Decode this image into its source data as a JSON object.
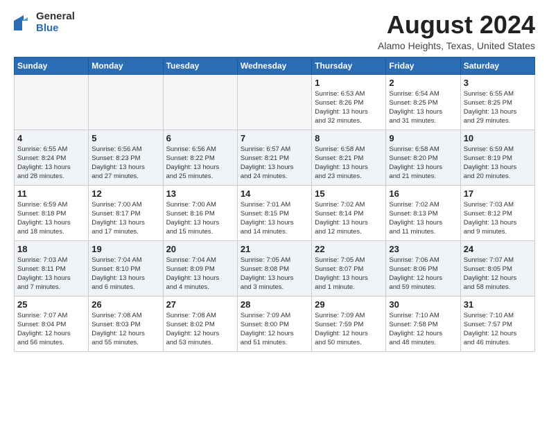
{
  "header": {
    "logo_general": "General",
    "logo_blue": "Blue",
    "month_year": "August 2024",
    "location": "Alamo Heights, Texas, United States"
  },
  "days_of_week": [
    "Sunday",
    "Monday",
    "Tuesday",
    "Wednesday",
    "Thursday",
    "Friday",
    "Saturday"
  ],
  "weeks": [
    [
      {
        "day": "",
        "info": ""
      },
      {
        "day": "",
        "info": ""
      },
      {
        "day": "",
        "info": ""
      },
      {
        "day": "",
        "info": ""
      },
      {
        "day": "1",
        "info": "Sunrise: 6:53 AM\nSunset: 8:26 PM\nDaylight: 13 hours\nand 32 minutes."
      },
      {
        "day": "2",
        "info": "Sunrise: 6:54 AM\nSunset: 8:25 PM\nDaylight: 13 hours\nand 31 minutes."
      },
      {
        "day": "3",
        "info": "Sunrise: 6:55 AM\nSunset: 8:25 PM\nDaylight: 13 hours\nand 29 minutes."
      }
    ],
    [
      {
        "day": "4",
        "info": "Sunrise: 6:55 AM\nSunset: 8:24 PM\nDaylight: 13 hours\nand 28 minutes."
      },
      {
        "day": "5",
        "info": "Sunrise: 6:56 AM\nSunset: 8:23 PM\nDaylight: 13 hours\nand 27 minutes."
      },
      {
        "day": "6",
        "info": "Sunrise: 6:56 AM\nSunset: 8:22 PM\nDaylight: 13 hours\nand 25 minutes."
      },
      {
        "day": "7",
        "info": "Sunrise: 6:57 AM\nSunset: 8:21 PM\nDaylight: 13 hours\nand 24 minutes."
      },
      {
        "day": "8",
        "info": "Sunrise: 6:58 AM\nSunset: 8:21 PM\nDaylight: 13 hours\nand 23 minutes."
      },
      {
        "day": "9",
        "info": "Sunrise: 6:58 AM\nSunset: 8:20 PM\nDaylight: 13 hours\nand 21 minutes."
      },
      {
        "day": "10",
        "info": "Sunrise: 6:59 AM\nSunset: 8:19 PM\nDaylight: 13 hours\nand 20 minutes."
      }
    ],
    [
      {
        "day": "11",
        "info": "Sunrise: 6:59 AM\nSunset: 8:18 PM\nDaylight: 13 hours\nand 18 minutes."
      },
      {
        "day": "12",
        "info": "Sunrise: 7:00 AM\nSunset: 8:17 PM\nDaylight: 13 hours\nand 17 minutes."
      },
      {
        "day": "13",
        "info": "Sunrise: 7:00 AM\nSunset: 8:16 PM\nDaylight: 13 hours\nand 15 minutes."
      },
      {
        "day": "14",
        "info": "Sunrise: 7:01 AM\nSunset: 8:15 PM\nDaylight: 13 hours\nand 14 minutes."
      },
      {
        "day": "15",
        "info": "Sunrise: 7:02 AM\nSunset: 8:14 PM\nDaylight: 13 hours\nand 12 minutes."
      },
      {
        "day": "16",
        "info": "Sunrise: 7:02 AM\nSunset: 8:13 PM\nDaylight: 13 hours\nand 11 minutes."
      },
      {
        "day": "17",
        "info": "Sunrise: 7:03 AM\nSunset: 8:12 PM\nDaylight: 13 hours\nand 9 minutes."
      }
    ],
    [
      {
        "day": "18",
        "info": "Sunrise: 7:03 AM\nSunset: 8:11 PM\nDaylight: 13 hours\nand 7 minutes."
      },
      {
        "day": "19",
        "info": "Sunrise: 7:04 AM\nSunset: 8:10 PM\nDaylight: 13 hours\nand 6 minutes."
      },
      {
        "day": "20",
        "info": "Sunrise: 7:04 AM\nSunset: 8:09 PM\nDaylight: 13 hours\nand 4 minutes."
      },
      {
        "day": "21",
        "info": "Sunrise: 7:05 AM\nSunset: 8:08 PM\nDaylight: 13 hours\nand 3 minutes."
      },
      {
        "day": "22",
        "info": "Sunrise: 7:05 AM\nSunset: 8:07 PM\nDaylight: 13 hours\nand 1 minute."
      },
      {
        "day": "23",
        "info": "Sunrise: 7:06 AM\nSunset: 8:06 PM\nDaylight: 12 hours\nand 59 minutes."
      },
      {
        "day": "24",
        "info": "Sunrise: 7:07 AM\nSunset: 8:05 PM\nDaylight: 12 hours\nand 58 minutes."
      }
    ],
    [
      {
        "day": "25",
        "info": "Sunrise: 7:07 AM\nSunset: 8:04 PM\nDaylight: 12 hours\nand 56 minutes."
      },
      {
        "day": "26",
        "info": "Sunrise: 7:08 AM\nSunset: 8:03 PM\nDaylight: 12 hours\nand 55 minutes."
      },
      {
        "day": "27",
        "info": "Sunrise: 7:08 AM\nSunset: 8:02 PM\nDaylight: 12 hours\nand 53 minutes."
      },
      {
        "day": "28",
        "info": "Sunrise: 7:09 AM\nSunset: 8:00 PM\nDaylight: 12 hours\nand 51 minutes."
      },
      {
        "day": "29",
        "info": "Sunrise: 7:09 AM\nSunset: 7:59 PM\nDaylight: 12 hours\nand 50 minutes."
      },
      {
        "day": "30",
        "info": "Sunrise: 7:10 AM\nSunset: 7:58 PM\nDaylight: 12 hours\nand 48 minutes."
      },
      {
        "day": "31",
        "info": "Sunrise: 7:10 AM\nSunset: 7:57 PM\nDaylight: 12 hours\nand 46 minutes."
      }
    ]
  ]
}
